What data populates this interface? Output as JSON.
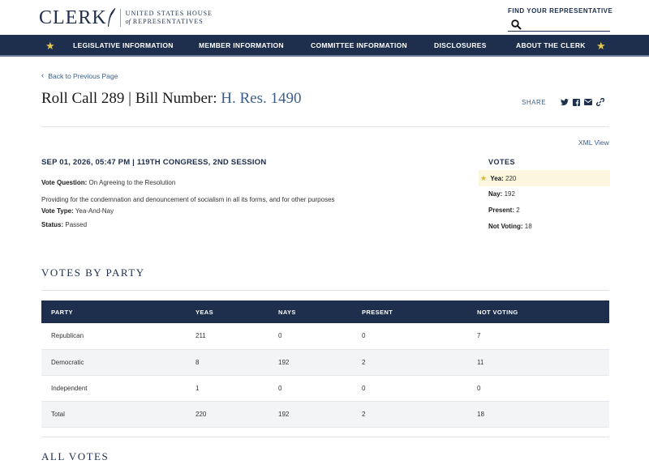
{
  "header": {
    "logo_word": "CLERK",
    "logo_line1": "UNITED STATES HOUSE",
    "logo_of": "of",
    "logo_line2": "REPRESENTATIVES",
    "find_rep_label": "FIND YOUR REPRESENTATIVE"
  },
  "nav": {
    "items": [
      "LEGISLATIVE INFORMATION",
      "MEMBER INFORMATION",
      "COMMITTEE INFORMATION",
      "DISCLOSURES",
      "ABOUT THE CLERK"
    ]
  },
  "page": {
    "back_link": "Back to Previous Page",
    "title_prefix": "Roll Call 289 | Bill Number:",
    "bill_number": "H. Res. 1490",
    "share_label": "SHARE",
    "xml_view": "XML View",
    "session_line": "SEP 01, 2026, 05:47 PM | 119TH CONGRESS, 2ND SESSION",
    "vote_question_label": "Vote Question:",
    "vote_question": "On Agreeing to the Resolution",
    "description": "Providing for the condemnation and denouncement of socialism in all its forms, and for other purposes",
    "vote_type_label": "Vote Type:",
    "vote_type": "Yea-And-Nay",
    "status_label": "Status:",
    "status": "Passed"
  },
  "votes": {
    "heading": "VOTES",
    "yea_label": "Yea:",
    "yea": "220",
    "nay_label": "Nay:",
    "nay": "192",
    "present_label": "Present:",
    "present": "2",
    "not_voting_label": "Not Voting:",
    "not_voting": "18"
  },
  "party_section": {
    "title": "VOTES BY PARTY",
    "columns": [
      "PARTY",
      "YEAS",
      "NAYS",
      "PRESENT",
      "NOT VOTING"
    ],
    "rows": [
      [
        "Republican",
        "211",
        "0",
        "0",
        "7"
      ],
      [
        "Democratic",
        "8",
        "192",
        "2",
        "11"
      ],
      [
        "Independent",
        "1",
        "0",
        "0",
        "0"
      ],
      [
        "Total",
        "220",
        "192",
        "2",
        "18"
      ]
    ]
  },
  "all_votes_title": "ALL VOTES",
  "colors": {
    "navy": "#1d2f4d",
    "link": "#3b5f8a",
    "star": "#e5c84a",
    "yea_highlight": "#fbf6dd"
  }
}
